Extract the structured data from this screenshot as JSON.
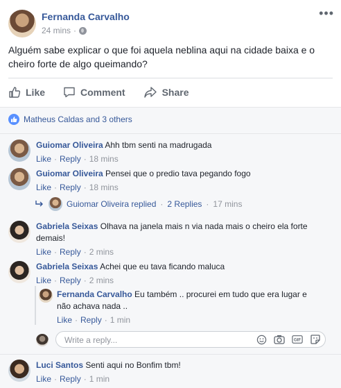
{
  "post": {
    "author": "Fernanda Carvalho",
    "time": "24 mins",
    "meta_sep": "·",
    "text": "Alguém sabe explicar o que foi aquela neblina aqui na cidade baixa e o cheiro forte de algo queimando?",
    "more": "•••"
  },
  "actions": {
    "like": "Like",
    "comment": "Comment",
    "share": "Share"
  },
  "reactions": {
    "names": "Matheus Caldas and 3 others"
  },
  "comments": [
    {
      "author": "Guiomar Oliveira",
      "text": "Ahh tbm senti na madrugada",
      "like": "Like",
      "reply": "Reply",
      "time": "18 mins"
    },
    {
      "author": "Guiomar Oliveira",
      "text": "Pensei que o predio tava pegando fogo",
      "like": "Like",
      "reply": "Reply",
      "time": "18 mins"
    },
    {
      "author": "Gabriela Seixas",
      "text": "Olhava na janela mais n via nada mais o cheiro ela forte demais!",
      "like": "Like",
      "reply": "Reply",
      "time": "2 mins"
    },
    {
      "author": "Gabriela Seixas",
      "text": "Achei que eu tava ficando maluca",
      "like": "Like",
      "reply": "Reply",
      "time": "2 mins"
    },
    {
      "author": "Luci Santos",
      "text": "Senti aqui no Bonfim tbm!",
      "like": "Like",
      "reply": "Reply",
      "time": "1 min"
    }
  ],
  "replies_summary": {
    "text": "Guiomar Oliveira replied",
    "sep": "·",
    "count": "2 Replies",
    "time": "17 mins"
  },
  "reply": {
    "author": "Fernanda Carvalho",
    "text": "Eu também .. procurei em tudo que era lugar e não achava nada ..",
    "like": "Like",
    "reply": "Reply",
    "time": "1 min"
  },
  "write_reply": {
    "placeholder": "Write a reply..."
  },
  "icons": {
    "globe": "globe-icon",
    "like": "thumbs-up-icon",
    "comment": "speech-bubble-icon",
    "share": "share-arrow-icon",
    "reply_arrow": "reply-arrow-icon",
    "emoji": "smiley-icon",
    "camera": "camera-icon",
    "gif": "gif-icon",
    "sticker": "sticker-icon"
  },
  "colors": {
    "link": "#365899",
    "meta": "#90949c",
    "like_badge": "#5890ff"
  }
}
